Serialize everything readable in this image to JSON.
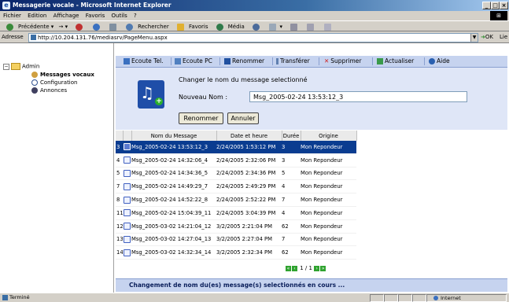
{
  "window": {
    "title": "Messagerie vocale - Microsoft Internet Explorer"
  },
  "menu": [
    "Fichier",
    "Edition",
    "Affichage",
    "Favoris",
    "Outils",
    "?"
  ],
  "toolbar": [
    "Précédente",
    "Rechercher",
    "Favoris",
    "Média"
  ],
  "address": {
    "label": "Adresse",
    "url": "http://10.204.131.76/mediasrv/PageMenu.aspx",
    "go": "OK",
    "links": "Lie"
  },
  "tree": {
    "root": "Admin",
    "items": [
      "Messages vocaux",
      "Configuration",
      "Annonces"
    ]
  },
  "actions": [
    "Ecoute Tel.",
    "Ecoute PC",
    "Renommer",
    "Transférer",
    "Supprimer",
    "Actualiser",
    "Aide"
  ],
  "rename": {
    "heading": "Changer le nom du message selectionné",
    "field_label": "Nouveau Nom :",
    "field_value": "Msg_2005-02-24 13:53:12_3",
    "ok_label": "Renommer",
    "cancel_label": "Annuler"
  },
  "table": {
    "headers": [
      "Nom du Message",
      "Date et heure",
      "Durée",
      "Origine"
    ],
    "rows": [
      {
        "num": "3",
        "name": "Msg_2005-02-24 13:53:12_3",
        "date": "2/24/2005 1:53:12 PM",
        "dur": "3",
        "origin": "Mon Repondeur",
        "selected": true
      },
      {
        "num": "4",
        "name": "Msg_2005-02-24 14:32:06_4",
        "date": "2/24/2005 2:32:06 PM",
        "dur": "3",
        "origin": "Mon Repondeur",
        "selected": false
      },
      {
        "num": "5",
        "name": "Msg_2005-02-24 14:34:36_5",
        "date": "2/24/2005 2:34:36 PM",
        "dur": "5",
        "origin": "Mon Repondeur",
        "selected": false
      },
      {
        "num": "7",
        "name": "Msg_2005-02-24 14:49:29_7",
        "date": "2/24/2005 2:49:29 PM",
        "dur": "4",
        "origin": "Mon Repondeur",
        "selected": false
      },
      {
        "num": "8",
        "name": "Msg_2005-02-24 14:52:22_8",
        "date": "2/24/2005 2:52:22 PM",
        "dur": "7",
        "origin": "Mon Repondeur",
        "selected": false
      },
      {
        "num": "11",
        "name": "Msg_2005-02-24 15:04:39_11",
        "date": "2/24/2005 3:04:39 PM",
        "dur": "4",
        "origin": "Mon Repondeur",
        "selected": false
      },
      {
        "num": "12",
        "name": "Msg_2005-03-02 14:21:04_12",
        "date": "3/2/2005 2:21:04 PM",
        "dur": "62",
        "origin": "Mon Repondeur",
        "selected": false
      },
      {
        "num": "13",
        "name": "Msg_2005-03-02 14:27:04_13",
        "date": "3/2/2005 2:27:04 PM",
        "dur": "7",
        "origin": "Mon Repondeur",
        "selected": false
      },
      {
        "num": "14",
        "name": "Msg_2005-03-02 14:32:34_14",
        "date": "3/2/2005 2:32:34 PM",
        "dur": "62",
        "origin": "Mon Repondeur",
        "selected": false
      }
    ]
  },
  "pager": {
    "text": "1 / 1"
  },
  "status_message": "Changement de nom du(es) message(s) selectionnés en cours ...",
  "statusbar": {
    "left": "Terminé",
    "zone": "Internet"
  }
}
